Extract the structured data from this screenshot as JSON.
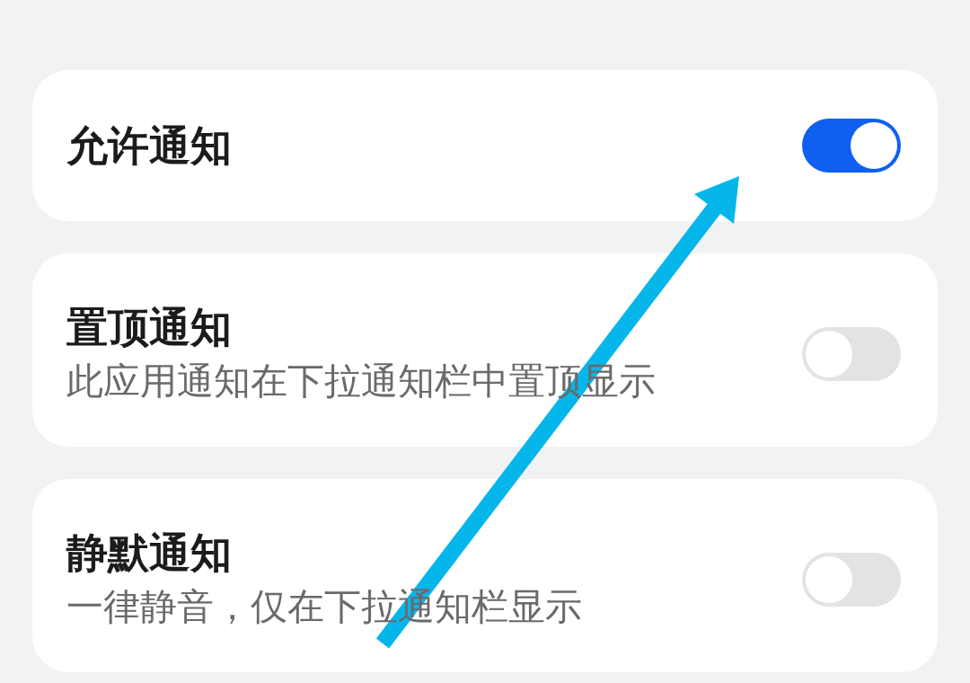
{
  "settings": [
    {
      "title": "允许通知",
      "on": true
    },
    {
      "title": "置顶通知",
      "description": "此应用通知在下拉通知栏中置顶显示",
      "on": false
    },
    {
      "title": "静默通知",
      "description": "一律静音，仅在下拉通知栏显示",
      "on": false
    }
  ]
}
